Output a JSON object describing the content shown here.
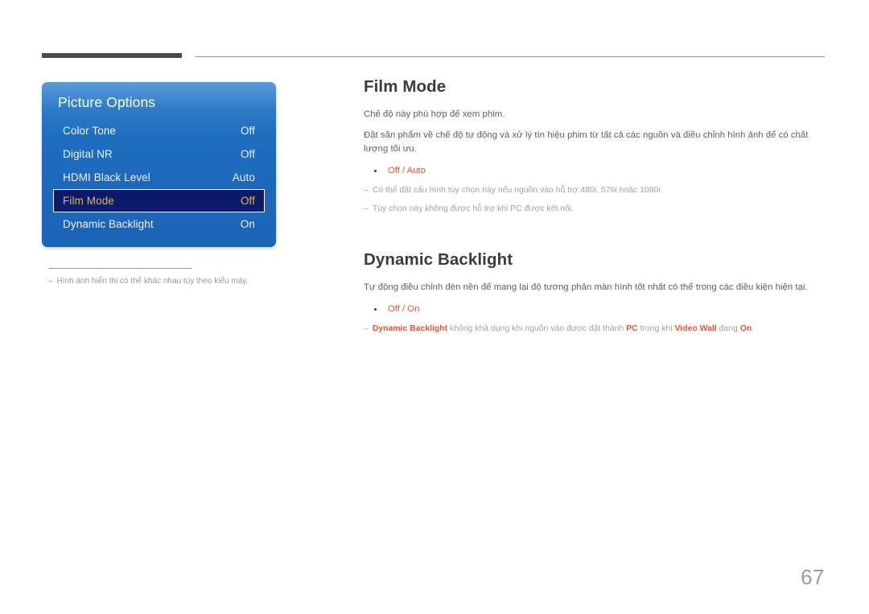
{
  "page": {
    "number": "67"
  },
  "osd": {
    "title": "Picture Options",
    "rows": [
      {
        "label": "Color Tone",
        "value": "Off",
        "selected": false
      },
      {
        "label": "Digital NR",
        "value": "Off",
        "selected": false
      },
      {
        "label": "HDMI Black Level",
        "value": "Auto",
        "selected": false
      },
      {
        "label": "Film Mode",
        "value": "Off",
        "selected": true
      },
      {
        "label": "Dynamic Backlight",
        "value": "On",
        "selected": false
      }
    ],
    "footnote": {
      "dash": "–",
      "text": "Hình ảnh hiển thị có thể khác nhau tùy theo kiểu máy."
    },
    "colors": {
      "panel_top": "#5b9bd8",
      "panel_bottom": "#1c63b6",
      "selected_bg": "#0d1a6b",
      "selected_text": "#e5b44a"
    }
  },
  "sections": {
    "film_mode": {
      "title": "Film Mode",
      "paragraph1": "Chế độ này phù hợp để xem phim.",
      "paragraph2": "Đặt sản phẩm về chế độ tự động và xử lý tín hiệu phim từ tất cả các nguồn và điều chỉnh hình ảnh để có chất lượng tối ưu.",
      "options": "Off / Auto",
      "note1": {
        "dash": "–",
        "text": "Có thể đặt cấu hình tùy chọn này nếu nguồn vào hỗ trợ 480i, 576i hoặc 1080i."
      },
      "note2": {
        "dash": "–",
        "text": "Tùy chọn này không được hỗ trợ khi PC được kết nối."
      }
    },
    "dynamic_backlight": {
      "title": "Dynamic Backlight",
      "paragraph1": "Tự động điều chỉnh đèn nền để mang lại độ tương phản màn hình tốt nhất có thể trong các điều kiện hiện tại.",
      "options": "Off / On",
      "note1": {
        "dash": "–",
        "seg1": "Dynamic Backlight",
        "seg2": " không khả dụng khi nguồn vào được đặt thành ",
        "seg3": "PC",
        "seg4": " trong khi ",
        "seg5": "Video Wall",
        "seg6": " đang ",
        "seg7": "On",
        "seg8": "."
      }
    }
  },
  "colors": {
    "accent": "#e1533a",
    "heading": "#3b3b3f",
    "body": "#5d5d64",
    "muted": "#a0a0a8",
    "rule_dark": "#4a4a57"
  }
}
